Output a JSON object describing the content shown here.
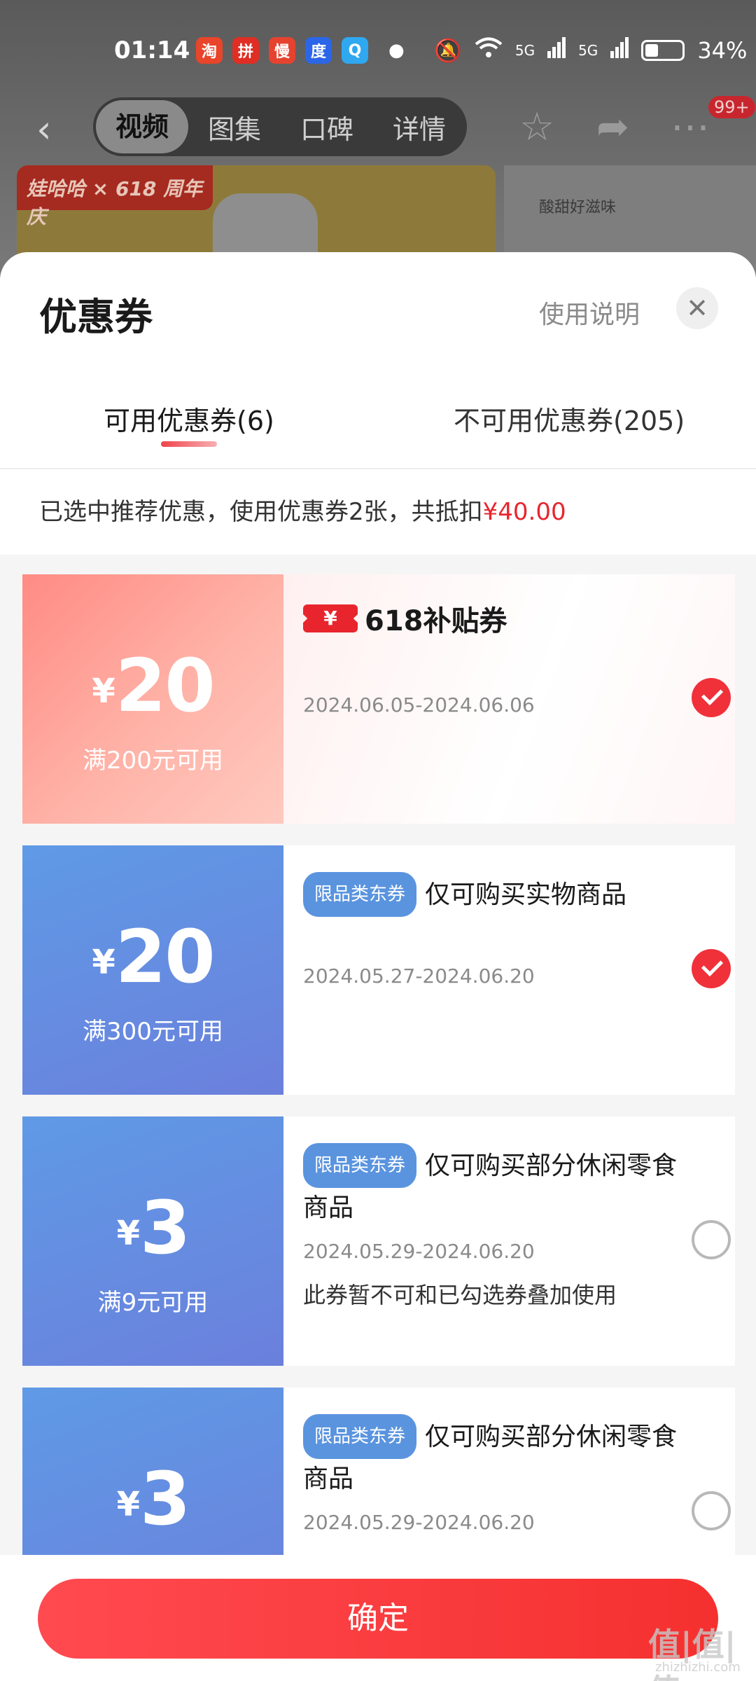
{
  "status_bar": {
    "time": "01:14",
    "apps": [
      {
        "name": "taobao-app-icon",
        "glyph": "淘",
        "color": "#e8452a"
      },
      {
        "name": "pinduoduo-app-icon",
        "glyph": "拼",
        "color": "#e02e24"
      },
      {
        "name": "manmanbuy-app-icon",
        "glyph": "慢",
        "color": "#e5432f"
      },
      {
        "name": "baidu-app-icon",
        "glyph": "度",
        "color": "#2b66e8"
      },
      {
        "name": "search-app-icon",
        "glyph": "Q",
        "color": "#2fa8f0"
      }
    ],
    "network_1": "5G",
    "network_2": "5G",
    "battery": "34%"
  },
  "nav": {
    "tabs": [
      "视频",
      "图集",
      "口碑",
      "详情"
    ],
    "active_tab": "视频",
    "badge": "99+"
  },
  "background_banner": {
    "brand": "娃哈哈 × 618 周年庆",
    "right_text": "酸甜好滋味"
  },
  "sheet": {
    "title": "优惠券",
    "help": "使用说明",
    "tabs": [
      "可用优惠券(6)",
      "不可用优惠券(205)"
    ],
    "summary_prefix": "已选中推荐优惠，使用优惠券2张，共抵扣",
    "summary_amount": "¥40.00"
  },
  "coupons": [
    {
      "yen": "¥",
      "amount": "20",
      "condition": "满200元可用",
      "special_tag": "¥",
      "special_title": "618补贴券",
      "date": "2024.06.05-2024.06.06",
      "selected": true
    },
    {
      "yen": "¥",
      "amount": "20",
      "condition": "满300元可用",
      "tag": "限品类东券",
      "title": "仅可购买实物商品",
      "date": "2024.05.27-2024.06.20",
      "selected": true
    },
    {
      "yen": "¥",
      "amount": "3",
      "condition": "满9元可用",
      "tag": "限品类东券",
      "title": "仅可购买部分休闲零食商品",
      "date": "2024.05.29-2024.06.20",
      "note": "此券暂不可和已勾选券叠加使用",
      "selected": false
    },
    {
      "yen": "¥",
      "amount": "3",
      "tag": "限品类东券",
      "title": "仅可购买部分休闲零食商品",
      "date": "2024.05.29-2024.06.20",
      "selected": false
    }
  ],
  "confirm_label": "确定",
  "watermark": {
    "main": "值|值|值",
    "sub": "zhizhizhi.com"
  },
  "colors": {
    "accent": "#e8252d",
    "blue_coupon": "#5f9ae6",
    "red_coupon": "#ff8b84"
  }
}
